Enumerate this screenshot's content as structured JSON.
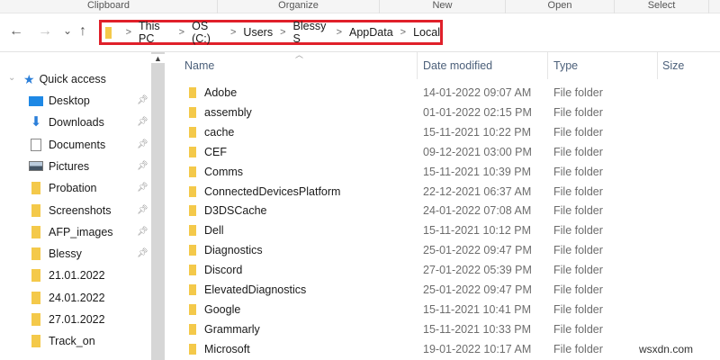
{
  "ribbon": {
    "groups": [
      "Clipboard",
      "Organize",
      "New",
      "Open",
      "Select"
    ]
  },
  "nav": {
    "back": "←",
    "forward": "→",
    "recent": "⌄",
    "up": "↑"
  },
  "address": {
    "crumbs": [
      "This PC",
      "OS (C:)",
      "Users",
      "Blessy S",
      "AppData",
      "Local"
    ]
  },
  "sidebar": {
    "quick_access": "Quick access",
    "items": [
      {
        "label": "Desktop",
        "icon": "desktop-icon",
        "pinned": true
      },
      {
        "label": "Downloads",
        "icon": "downloads-icon",
        "pinned": true
      },
      {
        "label": "Documents",
        "icon": "documents-icon",
        "pinned": true
      },
      {
        "label": "Pictures",
        "icon": "pictures-icon",
        "pinned": true
      },
      {
        "label": "Probation",
        "icon": "folder-icon",
        "pinned": true
      },
      {
        "label": "Screenshots",
        "icon": "folder-icon",
        "pinned": true
      },
      {
        "label": "AFP_images",
        "icon": "folder-icon",
        "pinned": true
      },
      {
        "label": "Blessy",
        "icon": "folder-icon",
        "pinned": true
      },
      {
        "label": "21.01.2022",
        "icon": "folder-icon",
        "pinned": false
      },
      {
        "label": "24.01.2022",
        "icon": "folder-icon",
        "pinned": false
      },
      {
        "label": "27.01.2022",
        "icon": "folder-icon",
        "pinned": false
      },
      {
        "label": "Track_on",
        "icon": "folder-icon",
        "pinned": false
      }
    ]
  },
  "columns": {
    "name": "Name",
    "date": "Date modified",
    "type": "Type",
    "size": "Size"
  },
  "files": [
    {
      "name": "Adobe",
      "date": "14-01-2022 09:07 AM",
      "type": "File folder"
    },
    {
      "name": "assembly",
      "date": "01-01-2022 02:15 PM",
      "type": "File folder"
    },
    {
      "name": "cache",
      "date": "15-11-2021 10:22 PM",
      "type": "File folder"
    },
    {
      "name": "CEF",
      "date": "09-12-2021 03:00 PM",
      "type": "File folder"
    },
    {
      "name": "Comms",
      "date": "15-11-2021 10:39 PM",
      "type": "File folder"
    },
    {
      "name": "ConnectedDevicesPlatform",
      "date": "22-12-2021 06:37 AM",
      "type": "File folder"
    },
    {
      "name": "D3DSCache",
      "date": "24-01-2022 07:08 AM",
      "type": "File folder"
    },
    {
      "name": "Dell",
      "date": "15-11-2021 10:12 PM",
      "type": "File folder"
    },
    {
      "name": "Diagnostics",
      "date": "25-01-2022 09:47 PM",
      "type": "File folder"
    },
    {
      "name": "Discord",
      "date": "27-01-2022 05:39 PM",
      "type": "File folder"
    },
    {
      "name": "ElevatedDiagnostics",
      "date": "25-01-2022 09:47 PM",
      "type": "File folder"
    },
    {
      "name": "Google",
      "date": "15-11-2021 10:41 PM",
      "type": "File folder"
    },
    {
      "name": "Grammarly",
      "date": "15-11-2021 10:33 PM",
      "type": "File folder"
    },
    {
      "name": "Microsoft",
      "date": "19-01-2022 10:17 AM",
      "type": "File folder"
    }
  ],
  "watermark": "wsxdn.com",
  "colors": {
    "highlight": "#e0202a",
    "folder": "#f4c94a"
  }
}
